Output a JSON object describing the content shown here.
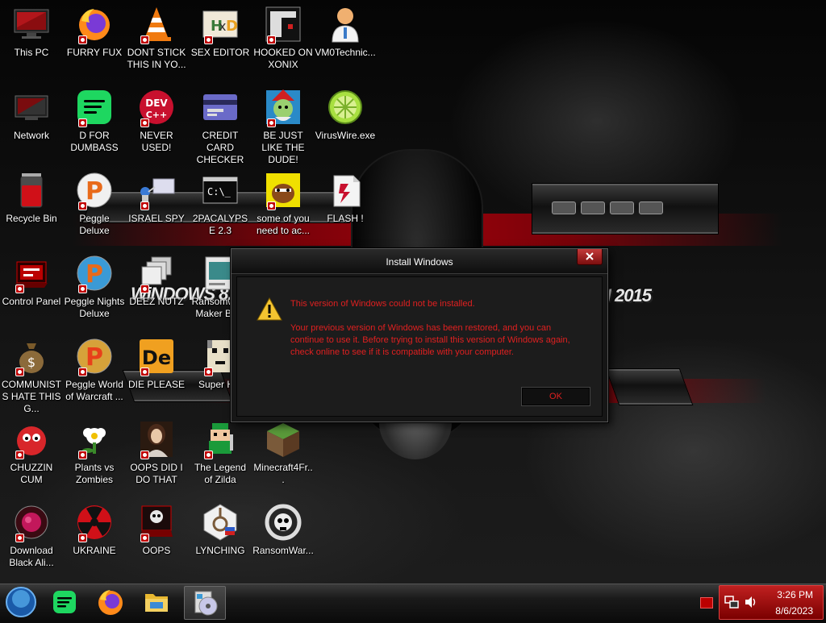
{
  "desktop": {
    "icons": [
      {
        "label": "This PC",
        "icon": "this-pc-icon"
      },
      {
        "label": "Network",
        "icon": "network-icon"
      },
      {
        "label": "Recycle Bin",
        "icon": "recycle-bin-icon"
      },
      {
        "label": "Control Panel",
        "icon": "control-panel-icon"
      },
      {
        "label": "COMMUNISTS HATE THIS G...",
        "icon": "money-bag-icon"
      },
      {
        "label": "CHUZZIN CUM",
        "icon": "chuzzle-icon"
      },
      {
        "label": "Download Black Ali...",
        "icon": "brain-icon"
      },
      {
        "label": "FURRY FUX",
        "icon": "firefox-icon"
      },
      {
        "label": "D FOR DUMBASS",
        "icon": "spotify-icon"
      },
      {
        "label": "Peggle Deluxe",
        "icon": "peggle-icon"
      },
      {
        "label": "Peggle Nights Deluxe",
        "icon": "peggle-nights-icon"
      },
      {
        "label": "Peggle World of Warcraft ...",
        "icon": "peggle-wow-icon"
      },
      {
        "label": "Plants vs Zombies",
        "icon": "plants-vs-zombies-icon"
      },
      {
        "label": "UKRAINE",
        "icon": "radiation-icon"
      },
      {
        "label": "DONT STICK THIS IN YO...",
        "icon": "vlc-cone-icon"
      },
      {
        "label": "NEVER USED!",
        "icon": "dev-cpp-icon"
      },
      {
        "label": "ISRAEL SPY",
        "icon": "spy-network-icon"
      },
      {
        "label": "DEEZ NUTZ",
        "icon": "windows-stack-icon"
      },
      {
        "label": "DIE PLEASE",
        "icon": "die-icon"
      },
      {
        "label": "OOPS DID I DO THAT",
        "icon": "portrait-icon"
      },
      {
        "label": "OOPS",
        "icon": "skull-monitor-icon"
      },
      {
        "label": "SEX EDITOR",
        "icon": "hxd-icon"
      },
      {
        "label": "CREDIT CARD CHECKER",
        "icon": "credit-card-icon"
      },
      {
        "label": "2PACALYPSE 2.3",
        "icon": "terminal-icon"
      },
      {
        "label": "Ransomware Maker Bu...",
        "icon": "ransomware-maker-icon"
      },
      {
        "label": "Super H...",
        "icon": "pixel-face-icon"
      },
      {
        "label": "The Legend of Zilda",
        "icon": "zilda-icon"
      },
      {
        "label": "LYNCHING",
        "icon": "noose-icon"
      },
      {
        "label": "HOOKED ON XONIX",
        "icon": "xonix-icon"
      },
      {
        "label": "BE JUST LIKE THE DUDE!",
        "icon": "elf-icon"
      },
      {
        "label": "some of you need to ac...",
        "icon": "dog-icon"
      },
      {
        "label": "Minecraft4Fr...",
        "icon": "minecraft-icon"
      },
      {
        "label": "RansomWar...",
        "icon": "skull-ring-icon"
      },
      {
        "label": "VM0Technic...",
        "icon": "doctor-icon"
      },
      {
        "label": "VirusWire.exe",
        "icon": "limewire-icon"
      },
      {
        "label": "FLASH !",
        "icon": "flash-icon"
      }
    ]
  },
  "wallpaper": {
    "text_left": "WiNDOWS 8.1",
    "text_right": "N 2015"
  },
  "dialog": {
    "title": "Install Windows",
    "heading": "This version of Windows could not be installed.",
    "body": "Your previous version of Windows has been restored, and you can continue to use it.  Before trying to install this version of Windows again, check online to see if it is compatible with your computer.",
    "ok_label": "OK",
    "icon": "warning-icon",
    "text_color": "#e02020"
  },
  "taskbar": {
    "start": "start-orb-icon",
    "pinned": [
      "spotify-icon",
      "firefox-icon",
      "file-explorer-icon",
      "install-disc-icon"
    ],
    "tray": {
      "time": "3:26 PM",
      "date": "8/6/2023",
      "accent": "#b00000"
    }
  }
}
